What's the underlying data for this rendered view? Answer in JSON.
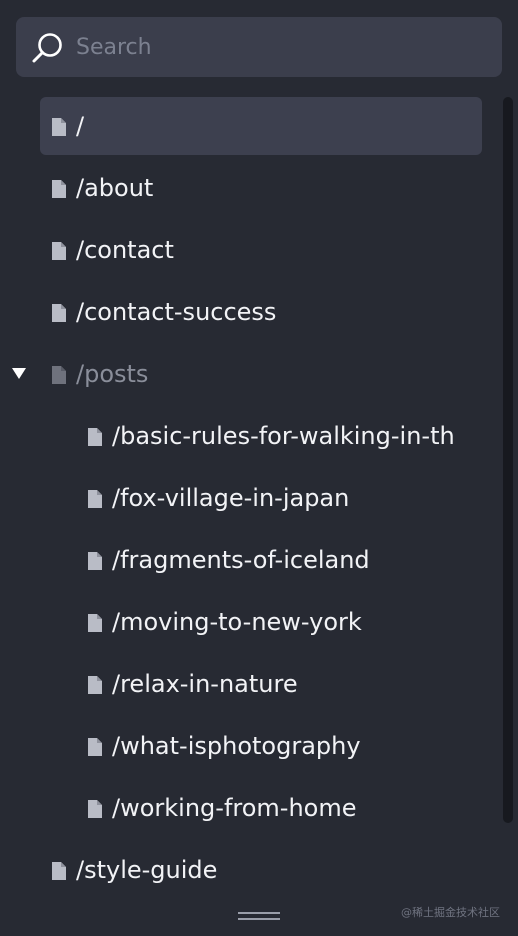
{
  "search": {
    "placeholder": "Search"
  },
  "tree": {
    "items": [
      {
        "label": "/",
        "selected": true
      },
      {
        "label": "/about"
      },
      {
        "label": "/contact"
      },
      {
        "label": "/contact-success"
      },
      {
        "label": "/posts",
        "expanded": true
      },
      {
        "label": "/basic-rules-for-walking-in-th"
      },
      {
        "label": "/fox-village-in-japan"
      },
      {
        "label": "/fragments-of-iceland"
      },
      {
        "label": "/moving-to-new-york"
      },
      {
        "label": "/relax-in-nature"
      },
      {
        "label": "/what-isphotography"
      },
      {
        "label": "/working-from-home"
      },
      {
        "label": "/style-guide"
      }
    ]
  },
  "icons": {
    "search": "search-icon",
    "page": "page-icon",
    "expand": "caret-down-icon"
  },
  "colors": {
    "background": "#272a33",
    "selected_row": "#3d404f",
    "search_bg": "#3b3e4c",
    "text": "#f2f3f6",
    "folder_text": "#8a8e9a"
  },
  "watermark": "@稀土掘金技术社区"
}
